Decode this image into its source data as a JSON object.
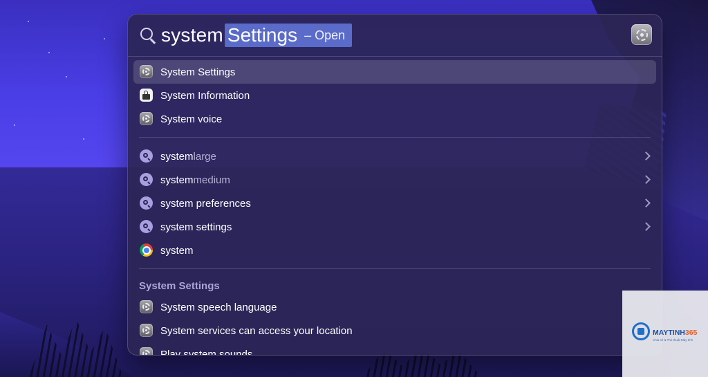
{
  "search": {
    "typed": "system",
    "completion": "Settings",
    "action_hint": "– Open"
  },
  "top_hits": [
    {
      "label": "System Settings",
      "icon": "gear-icon",
      "selected": true
    },
    {
      "label": "System Information",
      "icon": "system-information-icon",
      "selected": false
    },
    {
      "label": "System voice",
      "icon": "gear-icon",
      "selected": false
    }
  ],
  "suggestions": [
    {
      "prefix": "system",
      "suffix": "large",
      "icon": "search-suggestion-icon"
    },
    {
      "prefix": "system",
      "suffix": "medium",
      "icon": "search-suggestion-icon"
    },
    {
      "prefix": "system preferences",
      "suffix": "",
      "icon": "search-suggestion-icon"
    },
    {
      "prefix": "system settings",
      "suffix": "",
      "icon": "search-suggestion-icon"
    }
  ],
  "web_result": {
    "label": "system",
    "icon": "chrome-icon"
  },
  "section": {
    "title": "System Settings",
    "items": [
      {
        "label": "System speech language",
        "icon": "gear-icon"
      },
      {
        "label": "System services can access your location",
        "icon": "gear-icon"
      },
      {
        "label": "Play system sounds",
        "icon": "gear-icon"
      }
    ]
  },
  "watermark": {
    "brand_main": "MAYTINH",
    "brand_accent": "365",
    "tagline": "Chia sẻ & Thủ thuật Máy tính"
  },
  "colors": {
    "selection_highlight": "#5a6bc9",
    "panel_background": "#2c2656",
    "section_header": "#a9a5d6"
  }
}
